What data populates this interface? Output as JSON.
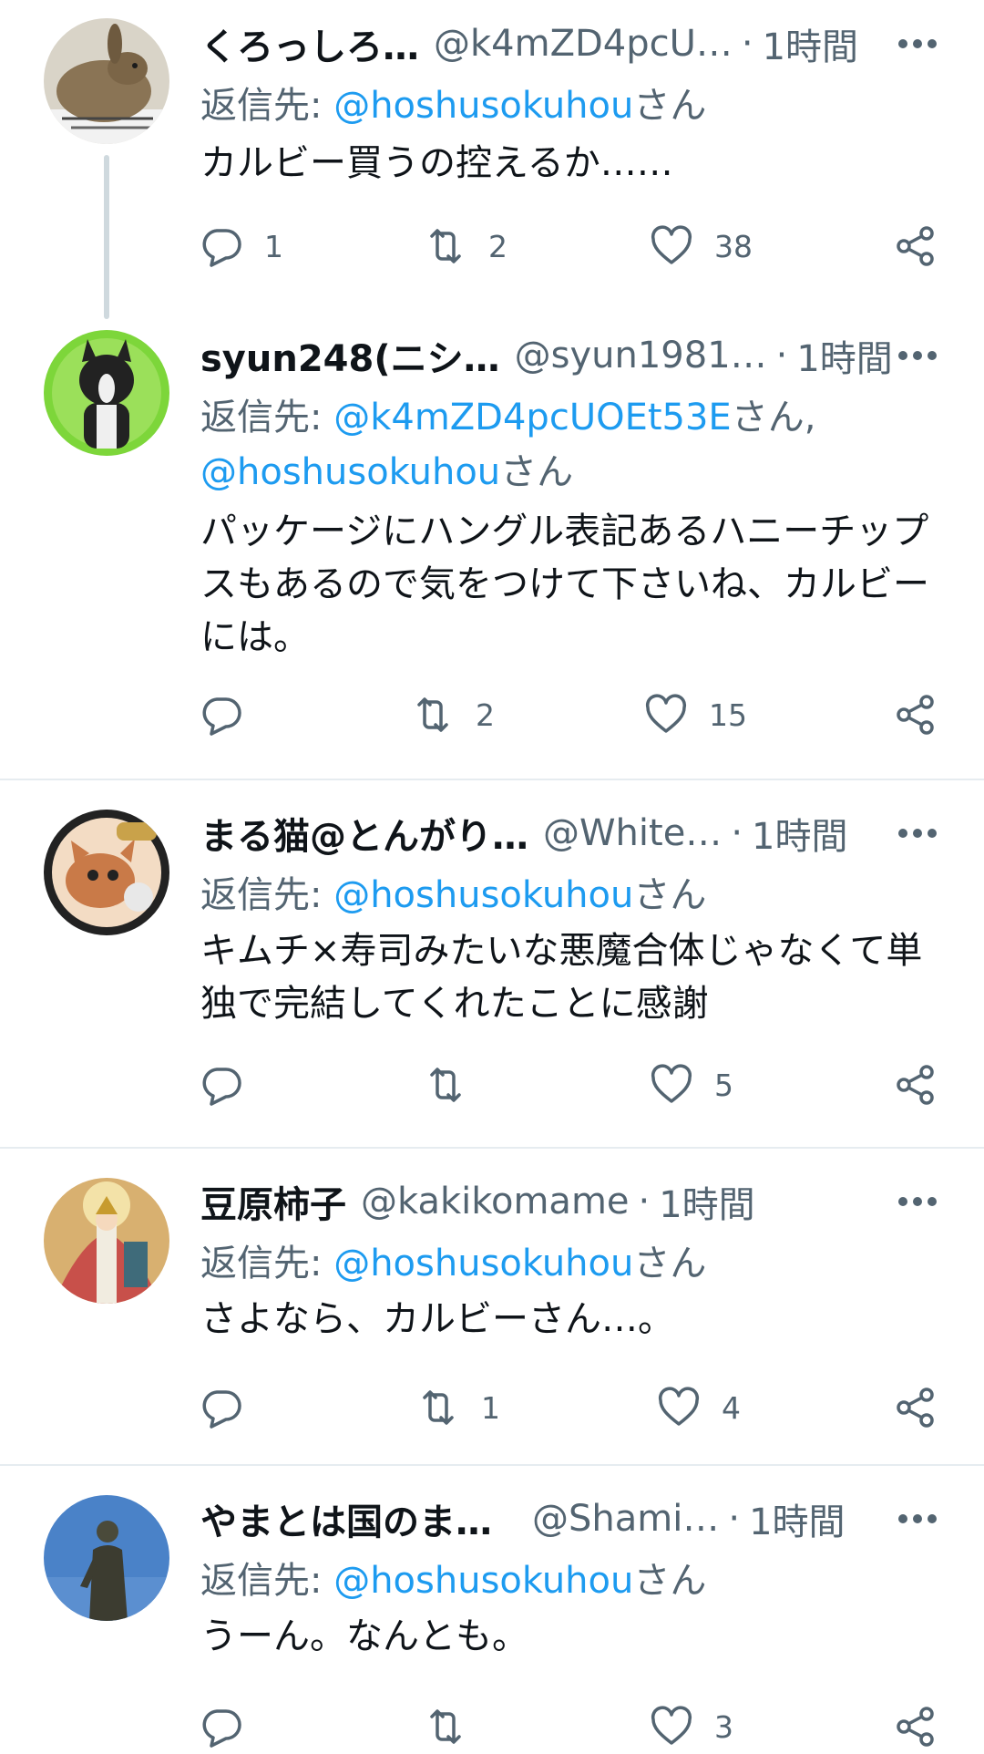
{
  "colors": {
    "text": "#0f1419",
    "secondary": "#536471",
    "mention": "#1d9bf0",
    "divider": "#e6ecf0",
    "thread": "#cfd9de"
  },
  "icons": {
    "more": "more-horizontal-icon",
    "reply": "reply-bubble-icon",
    "retweet": "retweet-icon",
    "like": "heart-icon",
    "share": "share-icon"
  },
  "tweets": [
    {
      "name": "くろっしろ…",
      "handle": "@k4mZD4pcU…",
      "dot": "·",
      "time": "1時間",
      "reply_prefix": "返信先: ",
      "mentions": [
        "@hoshusokuhou"
      ],
      "mention_suffix": "さん",
      "mention_sep": ", ",
      "text": "カルビー買うの控えるか……",
      "counts": {
        "reply": "1",
        "retweet": "2",
        "like": "38"
      }
    },
    {
      "name": "syun248(ニシ…",
      "handle": "@syun1981…",
      "dot": "·",
      "time": "1時間",
      "reply_prefix": "返信先: ",
      "mentions": [
        "@k4mZD4pcUOEt53E",
        "@hoshusokuhou"
      ],
      "mention_suffix": "さん",
      "mention_sep": ", ",
      "text": "パッケージにハングル表記あるハニーチップスもあるので気をつけて下さいね、カルビーには。",
      "counts": {
        "reply": "",
        "retweet": "2",
        "like": "15"
      }
    },
    {
      "name": "まる猫@とんがり…",
      "handle": "@White…",
      "dot": "·",
      "time": "1時間",
      "reply_prefix": "返信先: ",
      "mentions": [
        "@hoshusokuhou"
      ],
      "mention_suffix": "さん",
      "mention_sep": ", ",
      "text": "キムチ×寿司みたいな悪魔合体じゃなくて単独で完結してくれたことに感謝",
      "counts": {
        "reply": "",
        "retweet": "",
        "like": "5"
      }
    },
    {
      "name": "豆原柿子",
      "handle": "@kakikomame",
      "dot": "·",
      "time": "1時間",
      "reply_prefix": "返信先: ",
      "mentions": [
        "@hoshusokuhou"
      ],
      "mention_suffix": "さん",
      "mention_sep": ", ",
      "text": "さよなら、カルビーさん…。",
      "counts": {
        "reply": "",
        "retweet": "1",
        "like": "4"
      }
    },
    {
      "name": "やまとは国のま…",
      "handle": "@Shami…",
      "dot": "·",
      "time": "1時間",
      "reply_prefix": "返信先: ",
      "mentions": [
        "@hoshusokuhou"
      ],
      "mention_suffix": "さん",
      "mention_sep": ", ",
      "text": "うーん。なんとも。",
      "counts": {
        "reply": "",
        "retweet": "",
        "like": "3"
      }
    }
  ]
}
